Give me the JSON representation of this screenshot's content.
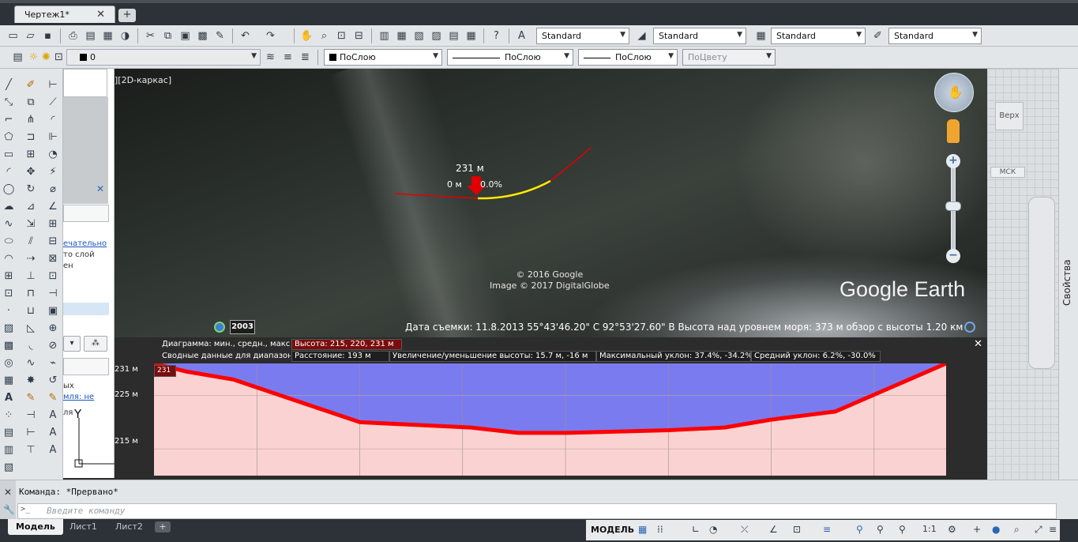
{
  "document_tab": {
    "title": "Чертеж1*",
    "close": "✕",
    "new_tab": "+"
  },
  "toolbar1": {
    "text_style": "Standard",
    "dim_style": "Standard",
    "table_style": "Standard",
    "mleader_style": "Standard"
  },
  "toolbar2": {
    "layer": "0",
    "color": "ПоСлою",
    "linetype": "ПоСлою",
    "lineweight": "ПоСлою",
    "plotstyle": "ПоЦвету"
  },
  "palette": {
    "close": "✕",
    "lines": [
      "ечательно",
      "то слой",
      "ен",
      "ых",
      "мля: не",
      "ля"
    ],
    "link1": "ечательно",
    "link2": "мля: не"
  },
  "viewport": {
    "label": "][2D-каркас]",
    "copyright_line1": "© 2016 Google",
    "copyright_line2": "Image © 2017 DigitalGlobe",
    "logo": "Google Earth",
    "meas_top": "231 м",
    "meas_left": "0 м",
    "meas_right": "0.0%",
    "year": "2003",
    "status": "Дата съемки: 11.8.2013    55°43'46.20\" С   92°53'27.60\" В  Высота над уровнем моря:  373 м     обзор с высоты  1.20 км"
  },
  "viewcube": {
    "face": "Верх",
    "wcs": "МСК"
  },
  "properties_tab": "Свойства",
  "profile": {
    "close": "✕",
    "row1_label": "Диаграмма: мин., средн., макс.",
    "row1_value": "Высота: 215, 220, 231 м",
    "row2_label": "Сводные данные для диапазона:",
    "row2_distance": "Расстояние: 193 м",
    "row2_change": "Увеличение/уменьшение высоты: 15.7 м, -16 м",
    "row2_maxslope": "Максимальный уклон: 37.4%, -34.2%",
    "row2_avgslope": "Средний уклон: 6.2%, -30.0%",
    "marker": "231",
    "y_ticks": [
      "231 м",
      "225 м",
      "215 м"
    ]
  },
  "chart_data": {
    "type": "area",
    "title": "",
    "xlabel": "",
    "ylabel": "",
    "ylim": [
      210,
      231
    ],
    "x": [
      0,
      0.04,
      0.1,
      0.22,
      0.26,
      0.4,
      0.46,
      0.52,
      0.65,
      0.72,
      0.78,
      0.86,
      1.0
    ],
    "series": [
      {
        "values": [
          231,
          229.5,
          228,
          222,
          220,
          219,
          218,
          218,
          218.5,
          219,
          220.5,
          222,
          231
        ]
      }
    ],
    "colors": {
      "profile_line": "#ff0000",
      "area_above": "#7b7bf0",
      "area_below": "#fbd2d2"
    }
  },
  "command": {
    "history": "Команда:  *Прервано*",
    "placeholder": "Введите команду",
    "prompt": ">_"
  },
  "layout_tabs": {
    "model": "Модель",
    "layout1": "Лист1",
    "layout2": "Лист2",
    "add": "+"
  },
  "statusbar": {
    "mode": "МОДЕЛЬ",
    "scale": "1:1"
  }
}
